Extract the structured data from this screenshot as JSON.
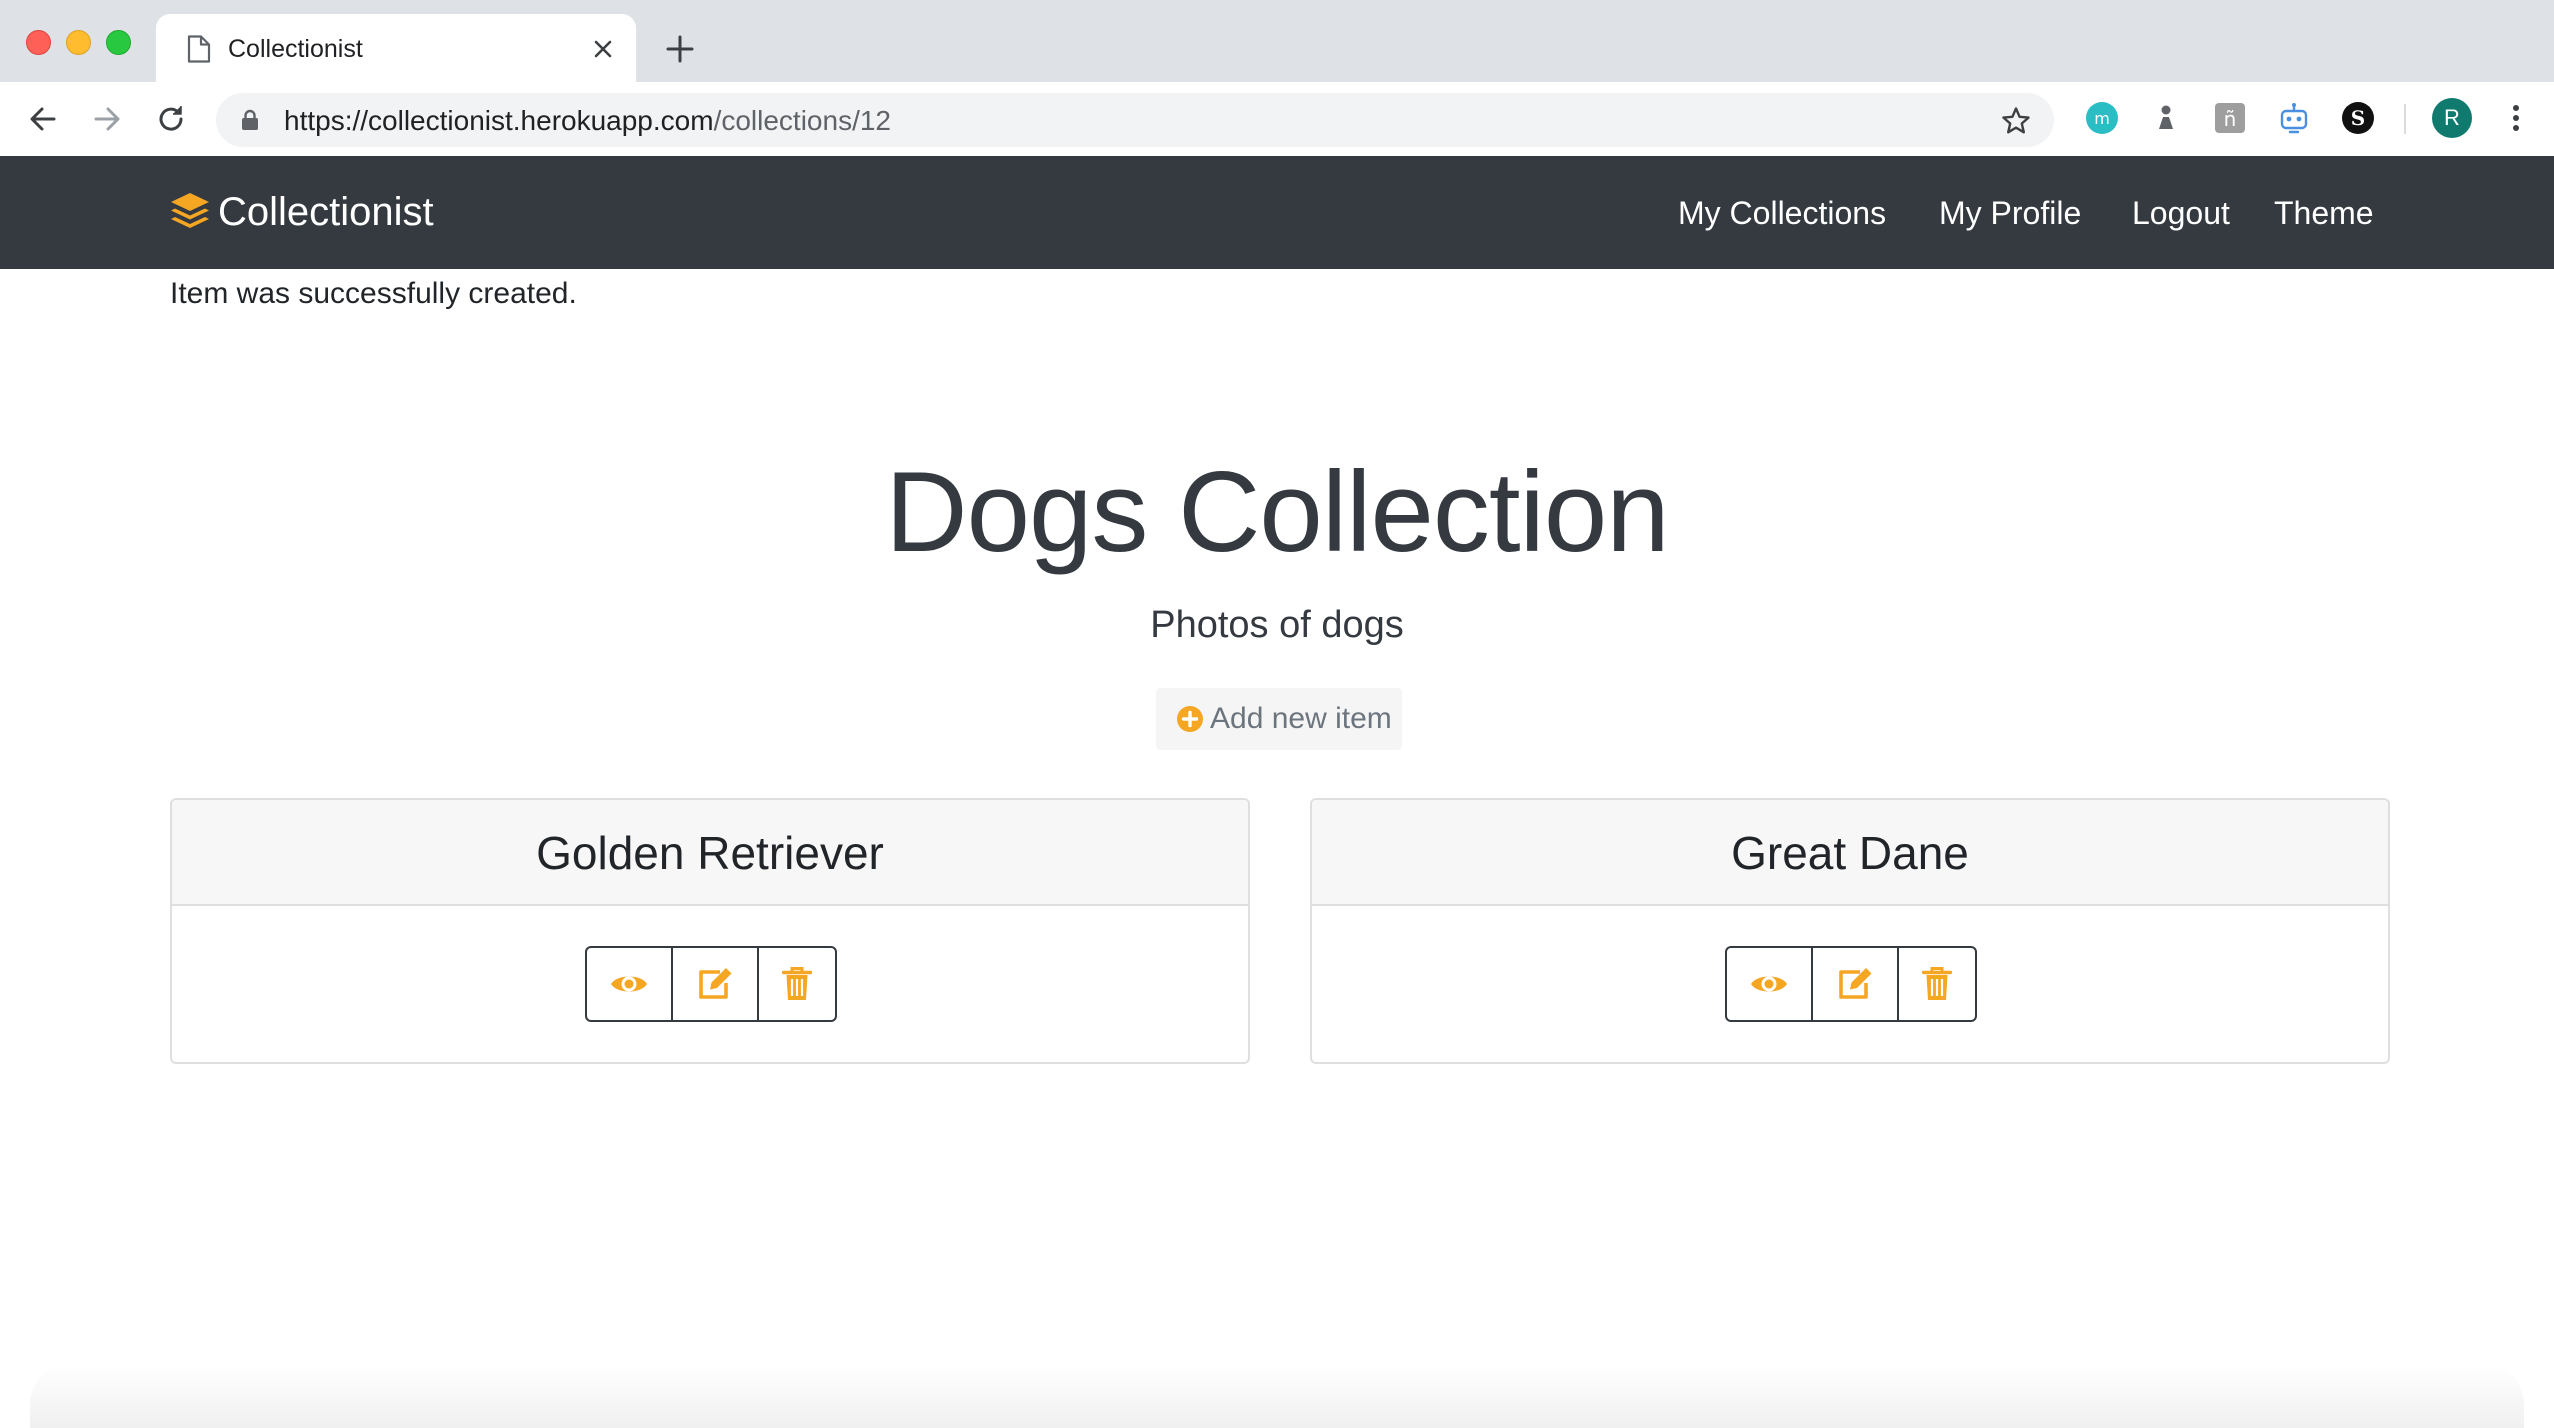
{
  "browser": {
    "tab_title": "Collectionist",
    "url_host": "https://collectionist.herokuapp.com",
    "url_path": "/collections/12",
    "profile_initial": "R"
  },
  "navbar": {
    "brand": "Collectionist",
    "links": [
      "My Collections",
      "My Profile",
      "Logout",
      "Theme"
    ]
  },
  "flash": "Item was successfully created.",
  "collection": {
    "title": "Dogs Collection",
    "description": "Photos of dogs",
    "add_button": "Add new item"
  },
  "items": [
    {
      "name": "Golden Retriever"
    },
    {
      "name": "Great Dane"
    }
  ],
  "colors": {
    "accent": "#f5a623",
    "navbar_bg": "#343a40",
    "chrome_bg": "#dee1e6"
  },
  "icons": {
    "brand": "layers-icon",
    "add": "plus-circle-icon",
    "view": "eye-icon",
    "edit": "edit-icon",
    "delete": "trash-icon"
  }
}
